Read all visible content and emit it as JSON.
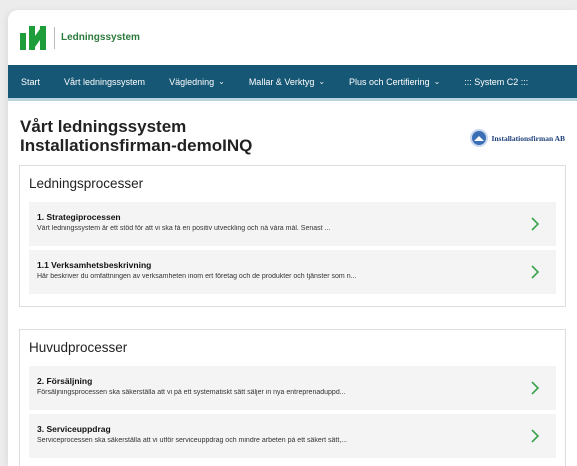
{
  "brand": {
    "name": "Ledningssystem"
  },
  "nav": {
    "items": [
      {
        "label": "Start",
        "dropdown": false
      },
      {
        "label": "Vårt ledningssystem",
        "dropdown": false
      },
      {
        "label": "Vägledning",
        "dropdown": true
      },
      {
        "label": "Mallar & Verktyg",
        "dropdown": true
      },
      {
        "label": "Plus och Certifiering",
        "dropdown": true
      },
      {
        "label": "::: System C2 :::",
        "dropdown": false
      }
    ]
  },
  "page": {
    "title_line1": "Vårt ledningssystem",
    "title_line2": "Installationsfirman-demoINQ",
    "company_name": "Installationsfirman AB"
  },
  "sections": [
    {
      "title": "Ledningsprocesser",
      "cards": [
        {
          "title": "1. Strategiprocessen",
          "desc": "Vårt ledningssystem är ett stöd för att vi ska få en positiv utveckling och nå våra mål. Senast ..."
        },
        {
          "title": "1.1 Verksamhetsbeskrivning",
          "desc": "Här beskriver du omfattningen av verksamheten inom ert företag och de produkter och tjänster som n..."
        }
      ]
    },
    {
      "title": "Huvudprocesser",
      "cards": [
        {
          "title": "2. Försäljning",
          "desc": "Försäljningsprocessen ska säkerställa att vi på ett systematiskt sätt säljer in nya entreprenaduppd..."
        },
        {
          "title": "3. Serviceuppdrag",
          "desc": "Serviceprocessen ska säkerställa att vi utför serviceuppdrag och mindre arbeten på ett säkert sätt,..."
        }
      ]
    }
  ],
  "colors": {
    "nav_bg": "#165775",
    "brand_green": "#1e9e3a",
    "chevron_green": "#3aa34a"
  }
}
